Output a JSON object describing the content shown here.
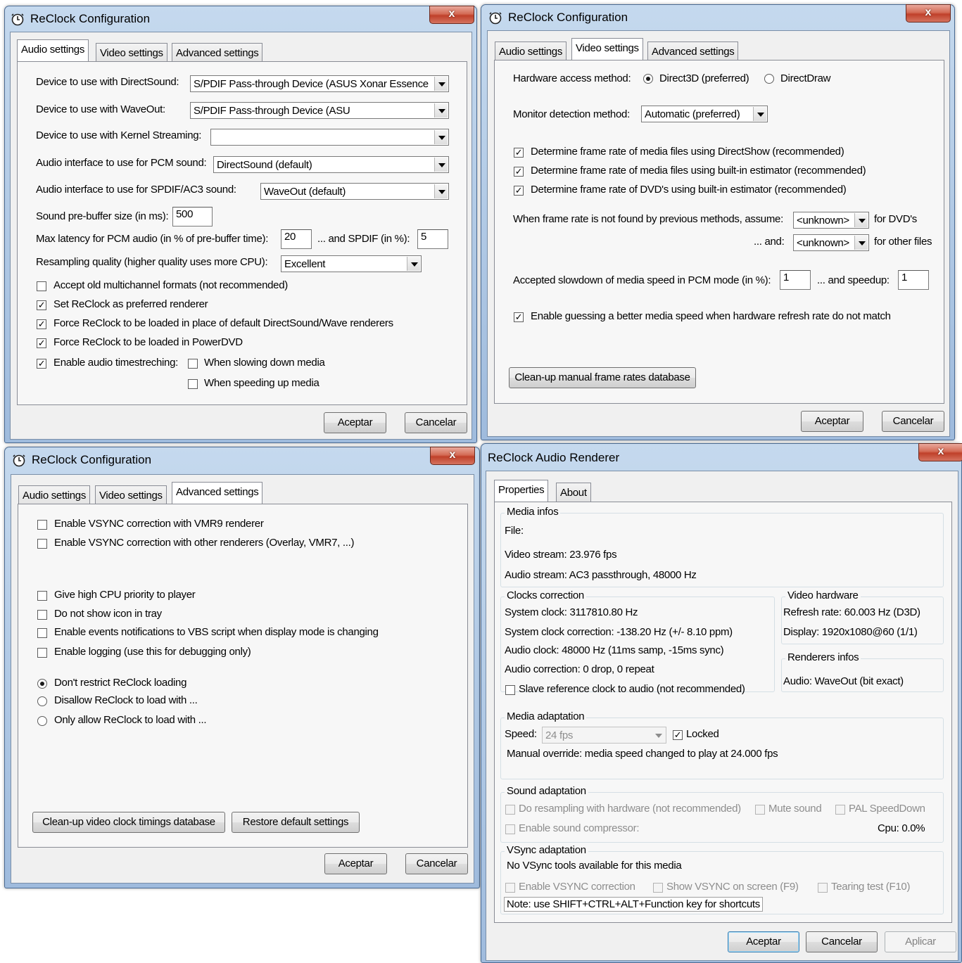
{
  "w1": {
    "title": "ReClock Configuration",
    "close": "x",
    "tabs": [
      "Audio settings",
      "Video settings",
      "Advanced settings"
    ],
    "ds_label": "Device to use with DirectSound:",
    "ds_value": "S/PDIF Pass-through Device (ASUS Xonar Essence",
    "wo_label": "Device to use with WaveOut:",
    "wo_value": "S/PDIF Pass-through Device (ASU",
    "ks_label": "Device to use with Kernel Streaming:",
    "ks_value": "",
    "pcm_label": "Audio interface to use for PCM sound:",
    "pcm_value": "DirectSound (default)",
    "spdif_label": "Audio interface to use for SPDIF/AC3 sound:",
    "spdif_value": "WaveOut (default)",
    "prebuf_label": "Sound pre-buffer size (in ms):",
    "prebuf_value": "500",
    "latency_label": "Max latency for PCM audio (in % of pre-buffer time):",
    "latency_value": "20",
    "latency_spdif_label": "... and SPDIF (in %):",
    "latency_spdif_value": "5",
    "resamp_label": "Resampling quality (higher quality uses more CPU):",
    "resamp_value": "Excellent",
    "cb_old": "Accept old multichannel formats (not recommended)",
    "cb_pref": "Set ReClock as preferred renderer",
    "cb_force": "Force ReClock to be loaded in place of default DirectSound/Wave renderers",
    "cb_pdvd": "Force ReClock to be loaded in PowerDVD",
    "cb_ts": "Enable audio timestreching:",
    "cb_slow": "When slowing down media",
    "cb_speed": "When speeding up media",
    "ok": "Aceptar",
    "cancel": "Cancelar"
  },
  "w2": {
    "title": "ReClock Configuration",
    "close": "x",
    "tabs": [
      "Audio settings",
      "Video settings",
      "Advanced settings"
    ],
    "hw_label": "Hardware access method:",
    "hw_d3d": "Direct3D (preferred)",
    "hw_dd": "DirectDraw",
    "mon_label": "Monitor detection method:",
    "mon_value": "Automatic (preferred)",
    "cb_ds": "Determine frame rate of media files using DirectShow (recommended)",
    "cb_bi": "Determine frame rate of media files using built-in estimator (recommended)",
    "cb_dvd": "Determine frame rate of DVD's using built-in estimator (recommended)",
    "nf_label": "When frame rate is not found by previous methods, assume:",
    "nf_value1": "<unknown>",
    "nf_dvd": "for DVD's",
    "and_label": "... and:",
    "nf_value2": "<unknown>",
    "nf_other": "for other files",
    "slow_label": "Accepted slowdown of media speed in PCM mode (in %):",
    "slow_value": "1",
    "speedup_label": "... and speedup:",
    "speedup_value": "1",
    "cb_guess": "Enable guessing a better media speed when hardware refresh rate do not match",
    "cleanup": "Clean-up manual frame rates database",
    "ok": "Aceptar",
    "cancel": "Cancelar"
  },
  "w3": {
    "title": "ReClock Configuration",
    "close": "x",
    "tabs": [
      "Audio settings",
      "Video settings",
      "Advanced settings"
    ],
    "cb_vmr9": "Enable VSYNC correction with VMR9 renderer",
    "cb_other": "Enable VSYNC correction with other renderers (Overlay, VMR7, ...)",
    "cb_cpu": "Give high CPU priority to player",
    "cb_icon": "Do not show icon in tray",
    "cb_vbs": "Enable events notifications to VBS script when display mode is changing",
    "cb_log": "Enable logging (use this for debugging only)",
    "r_dont": "Don't restrict ReClock loading",
    "r_disallow": "Disallow ReClock to load with ...",
    "r_only": "Only allow ReClock to load with ...",
    "cleanup": "Clean-up video clock timings database",
    "restore": "Restore default settings",
    "ok": "Aceptar",
    "cancel": "Cancelar"
  },
  "w4": {
    "title": "ReClock Audio Renderer",
    "close": "x",
    "tabs": [
      "Properties",
      "About"
    ],
    "media_infos": "Media infos",
    "file": "File:",
    "video_stream": "Video stream:  23.976 fps",
    "audio_stream": "Audio stream:  AC3 passthrough, 48000 Hz",
    "clocks": "Clocks correction",
    "sys_clock": "System clock:  3117810.80 Hz",
    "sys_corr": "System clock correction:  -138.20 Hz (+/- 8.10 ppm)",
    "audio_clock": "Audio clock:  48000 Hz (11ms samp, -15ms sync)",
    "audio_corr": "Audio correction: 0 drop, 0 repeat",
    "slave": "Slave reference clock to audio (not recommended)",
    "video_hw": "Video hardware",
    "refresh": "Refresh rate:  60.003 Hz (D3D)",
    "display": "Display:  1920x1080@60 (1/1)",
    "renderers": "Renderers infos",
    "audio_out": "Audio: WaveOut (bit exact)",
    "media_adapt": "Media adaptation",
    "speed_label": "Speed:",
    "speed_value": "24 fps",
    "locked": "Locked",
    "override": "Manual override: media speed changed to play at 24.000 fps",
    "sound_adapt": "Sound adaptation",
    "resamp_hw": "Do resampling with hardware (not recommended)",
    "mute": "Mute sound",
    "pal": "PAL SpeedDown",
    "compressor": "Enable sound compressor:",
    "cpu": "Cpu:  0.0%",
    "vsync_adapt": "VSync adaptation",
    "no_vsync": "No VSync tools available for this media",
    "en_vsync": "Enable VSYNC correction",
    "show_vsync": "Show VSYNC on screen (F9)",
    "tearing": "Tearing test (F10)",
    "note": "Note: use SHIFT+CTRL+ALT+Function key for shortcuts",
    "ok": "Aceptar",
    "cancel": "Cancelar",
    "apply": "Aplicar"
  }
}
